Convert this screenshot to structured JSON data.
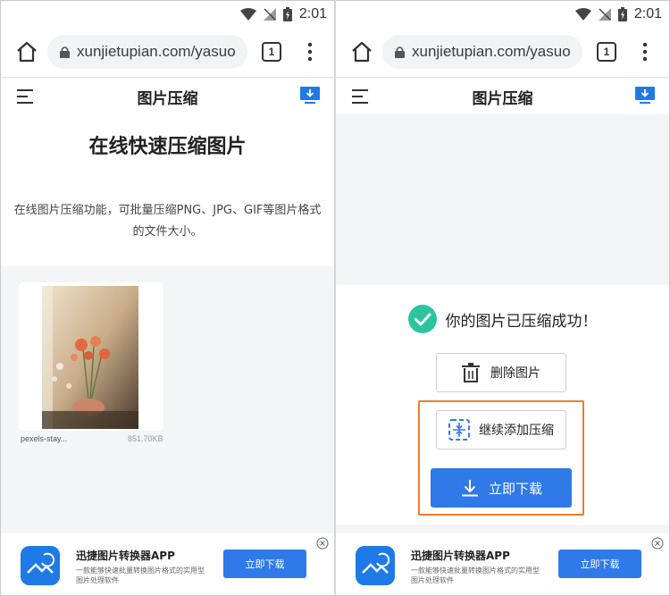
{
  "status": {
    "time": "2:01"
  },
  "browser": {
    "url": "xunjietupian.com/yasuo",
    "tab_count": "1"
  },
  "site": {
    "title": "图片压缩"
  },
  "left": {
    "hero_title": "在线快速压缩图片",
    "hero_desc_line1": "在线图片压缩功能，可批量压缩PNG、JPG、GIF等图片格式",
    "hero_desc_line2": "的文件大小。",
    "file_name": "pexels-stay...",
    "file_size": "851.70KB"
  },
  "right": {
    "success_text": "你的图片已压缩成功！",
    "delete_label": "删除图片",
    "add_label": "继续添加压缩",
    "download_label": "立即下载"
  },
  "ad": {
    "title": "迅捷图片转换器APP",
    "desc": "一款能够快速批量转换图片格式的实用型图片处理软件",
    "button": "立即下载"
  },
  "colors": {
    "accent": "#2f79e8",
    "success": "#2ec4a0",
    "highlight": "#ef7d2a"
  }
}
